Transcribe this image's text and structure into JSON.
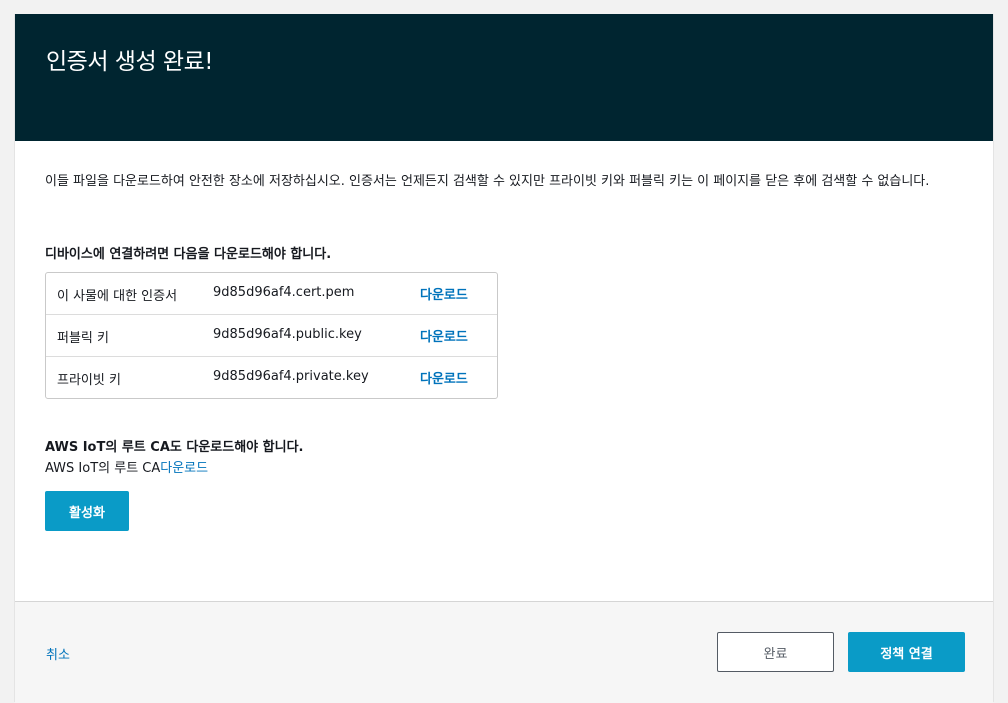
{
  "header": {
    "title": "인증서 생성 완료!"
  },
  "intro": {
    "text": "이들 파일을 다운로드하여 안전한 장소에 저장하십시오. 인증서는 언제든지 검색할 수 있지만 프라이빗 키와 퍼블릭 키는 이 페이지를 닫은 후에 검색할 수 없습니다."
  },
  "device_section": {
    "heading": "디바이스에 연결하려면 다음을 다운로드해야 합니다.",
    "files": [
      {
        "name": "이 사물에 대한 인증서",
        "file": "9d85d96af4.cert.pem",
        "link": "다운로드"
      },
      {
        "name": "퍼블릭 키",
        "file": "9d85d96af4.public.key",
        "link": "다운로드"
      },
      {
        "name": "프라이빗 키",
        "file": "9d85d96af4.private.key",
        "link": "다운로드"
      }
    ]
  },
  "ca_section": {
    "heading": "AWS IoT의 루트 CA도 다운로드해야 합니다.",
    "label": "AWS IoT의 루트 CA",
    "link": "다운로드"
  },
  "activate_button": "활성화",
  "footer": {
    "cancel": "취소",
    "done": "완료",
    "attach_policy": "정책 연결"
  },
  "colors": {
    "header_bg": "#002530",
    "primary_button": "#0a9bc7",
    "link": "#0073bb"
  }
}
